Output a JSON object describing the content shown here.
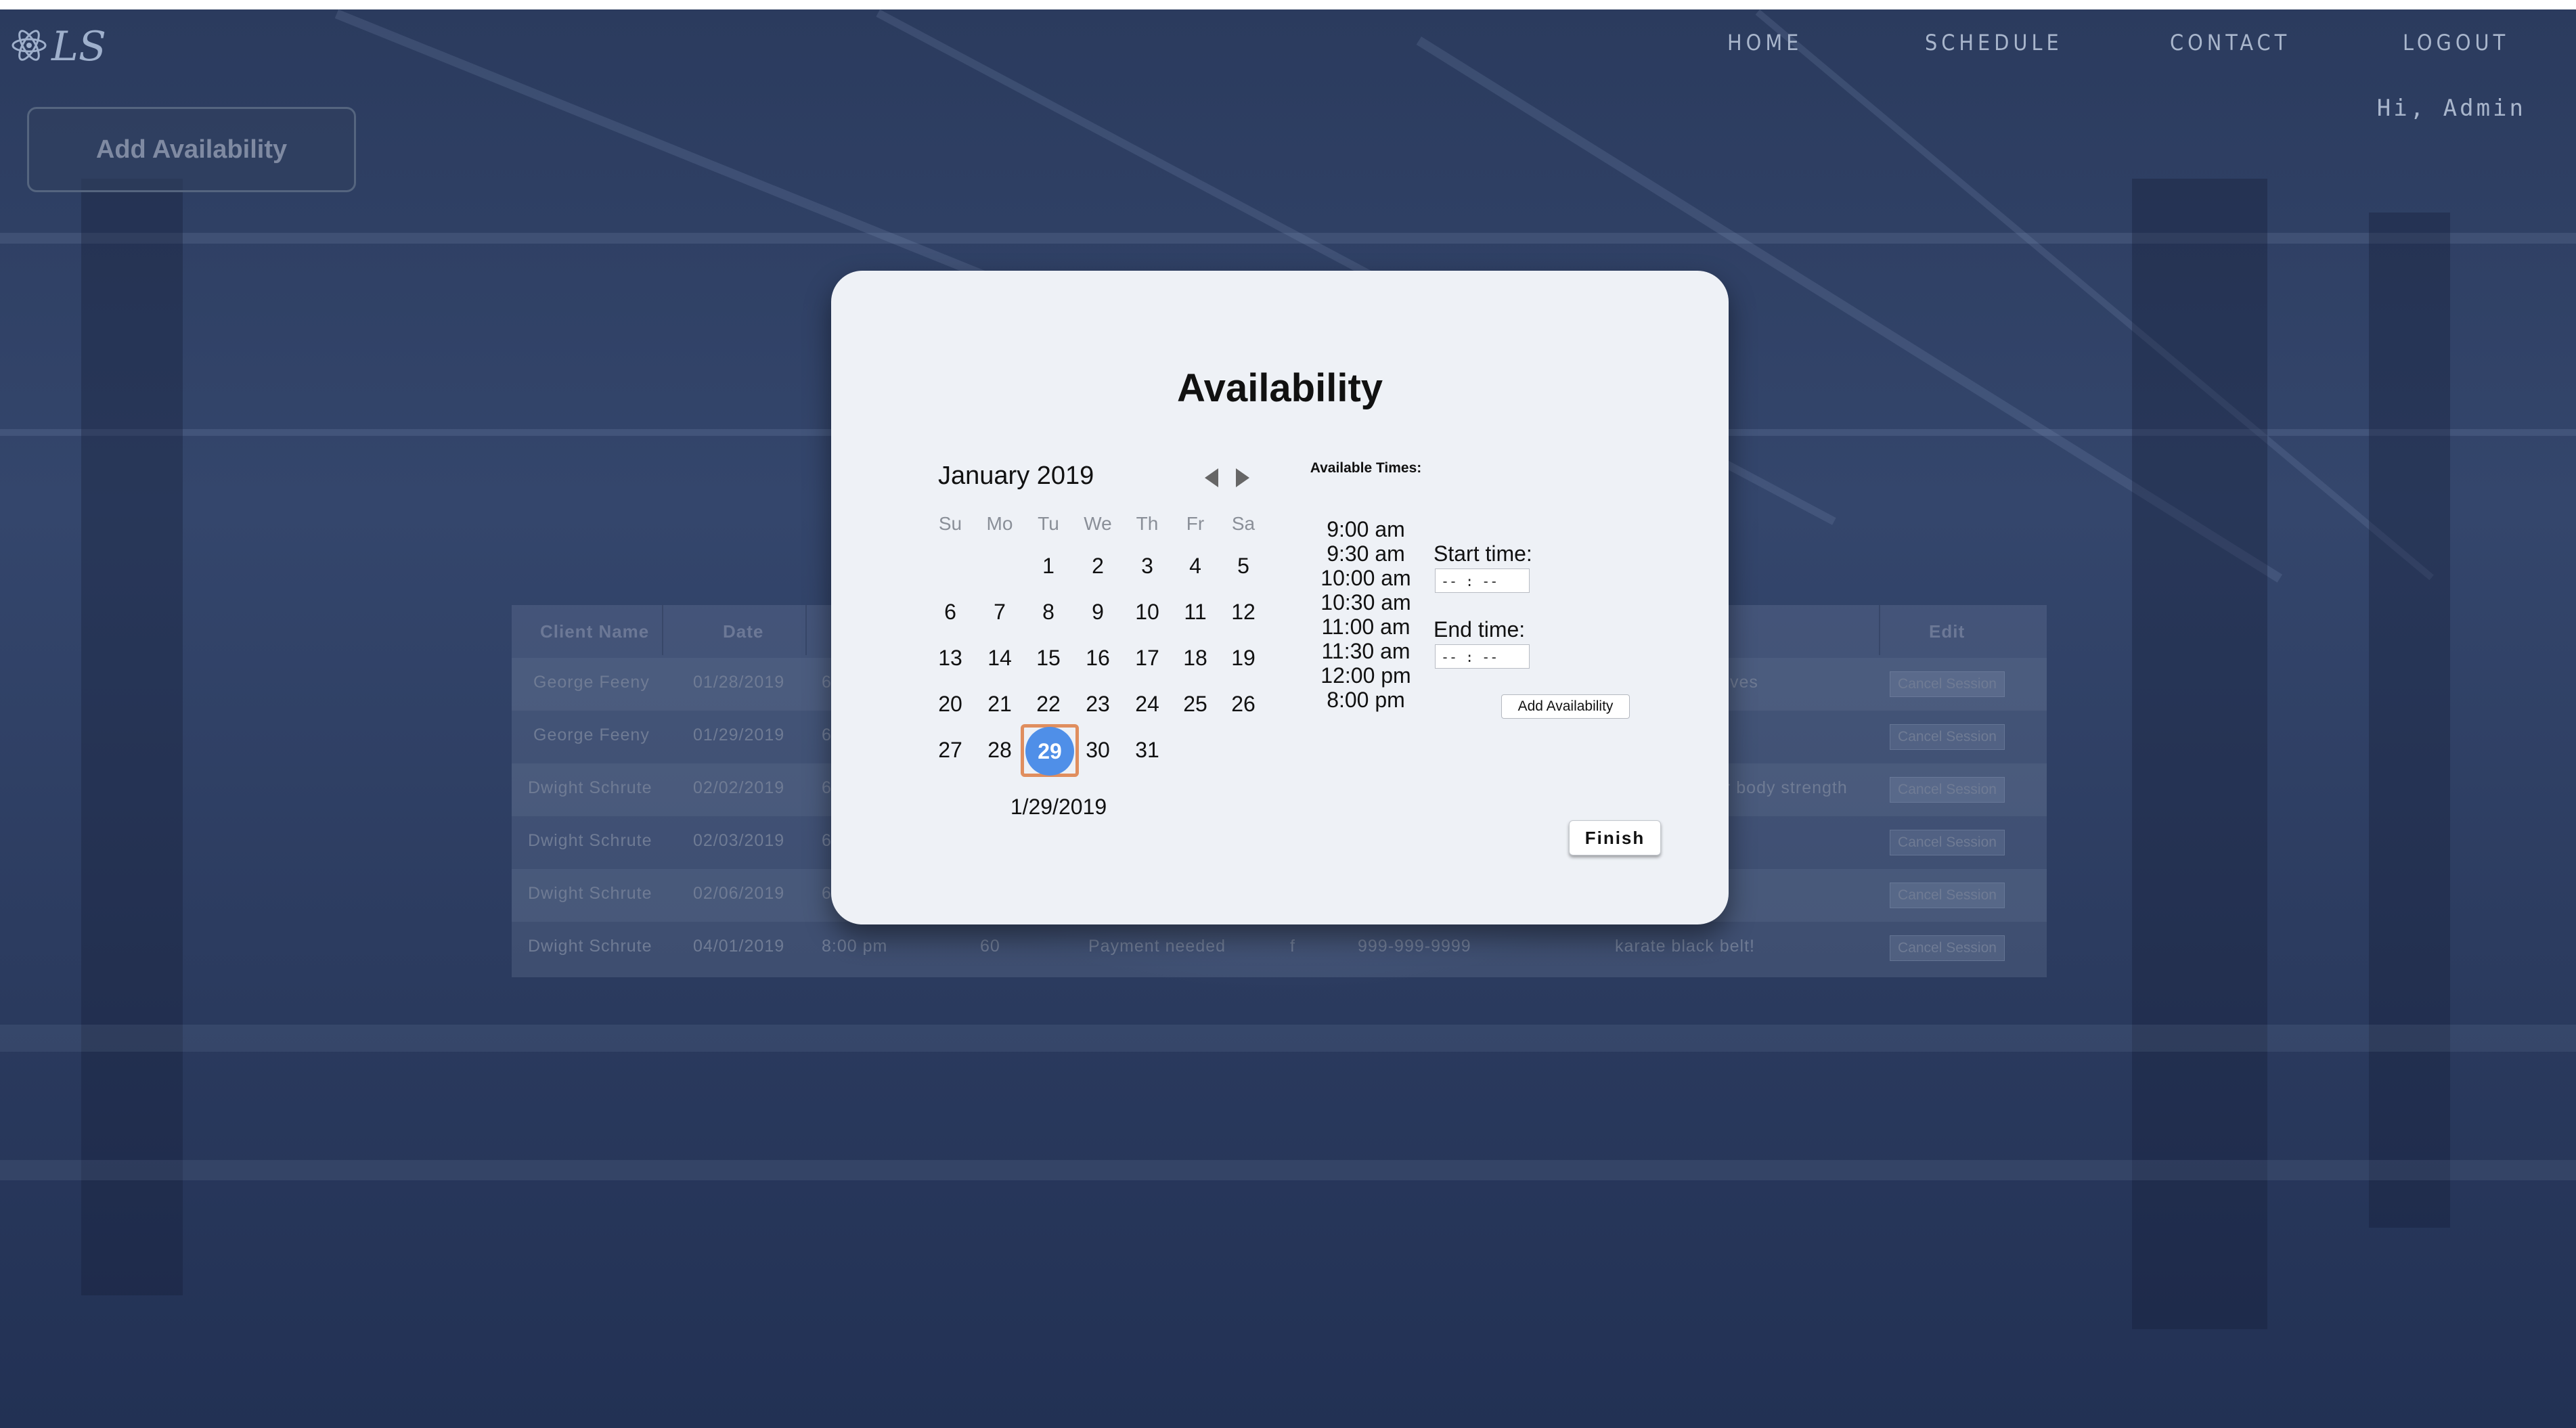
{
  "nav": {
    "logo_text": "LS",
    "links": [
      "HOME",
      "SCHEDULE",
      "CONTACT",
      "LOGOUT"
    ],
    "greeting": "Hi, Admin"
  },
  "main": {
    "add_availability_label": "Add Availability"
  },
  "table": {
    "headers": [
      "Client Name",
      "Date",
      "Edit"
    ],
    "rows": [
      {
        "client": "George Feeny",
        "date": "01/28/2019",
        "time": "6",
        "duration": "",
        "status": "",
        "gender": "",
        "phone": "",
        "notes": "ves",
        "action": "Cancel Session"
      },
      {
        "client": "George Feeny",
        "date": "01/29/2019",
        "time": "6",
        "duration": "",
        "status": "",
        "gender": "",
        "phone": "",
        "notes": "",
        "action": "Cancel Session"
      },
      {
        "client": "Dwight Schrute",
        "date": "02/02/2019",
        "time": "6",
        "duration": "",
        "status": "",
        "gender": "",
        "phone": "",
        "notes": "r body strength",
        "action": "Cancel Session"
      },
      {
        "client": "Dwight Schrute",
        "date": "02/03/2019",
        "time": "6",
        "duration": "",
        "status": "",
        "gender": "",
        "phone": "",
        "notes": "",
        "action": "Cancel Session"
      },
      {
        "client": "Dwight Schrute",
        "date": "02/06/2019",
        "time": "6",
        "duration": "",
        "status": "",
        "gender": "",
        "phone": "",
        "notes": "",
        "action": "Cancel Session"
      },
      {
        "client": "Dwight Schrute",
        "date": "04/01/2019",
        "time": "8:00 pm",
        "duration": "60",
        "status": "Payment needed",
        "gender": "f",
        "phone": "999-999-9999",
        "notes": "karate black belt!",
        "action": "Cancel Session"
      }
    ]
  },
  "modal": {
    "title": "Availability",
    "calendar": {
      "month_label": "January 2019",
      "weekdays": [
        "Su",
        "Mo",
        "Tu",
        "We",
        "Th",
        "Fr",
        "Sa"
      ],
      "days": [
        "1",
        "2",
        "3",
        "4",
        "5",
        "6",
        "7",
        "8",
        "9",
        "10",
        "11",
        "12",
        "13",
        "14",
        "15",
        "16",
        "17",
        "18",
        "19",
        "20",
        "21",
        "22",
        "23",
        "24",
        "25",
        "26",
        "27",
        "28",
        "29",
        "30",
        "31"
      ],
      "selected_day": "29",
      "selected_date": "1/29/2019"
    },
    "available_times_title": "Available Times:",
    "available_times": [
      "9:00 am",
      "9:30 am",
      "10:00 am",
      "10:30 am",
      "11:00 am",
      "11:30 am",
      "12:00 pm",
      "8:00 pm"
    ],
    "start_label": "Start time:",
    "end_label": "End time:",
    "time_placeholder": "-- : --",
    "add_button": "Add Availability",
    "finish_button": "Finish"
  },
  "icons": {
    "logo": "atom-icon",
    "prev": "chevron-left-icon",
    "next": "chevron-right-icon"
  },
  "colors": {
    "accent": "#4f8fe8",
    "focus_ring": "#e08e5e",
    "overlay": "#2b3b5e"
  }
}
